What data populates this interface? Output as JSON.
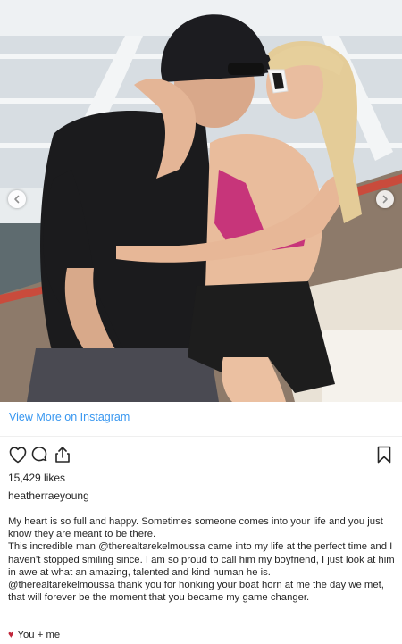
{
  "post": {
    "view_more_label": "View More on Instagram",
    "likes": "15,429 likes",
    "username": "heatherraeyoung",
    "caption": [
      "My heart is so full and happy. Sometimes someone comes into your life and you just know they are meant to be there.",
      "This incredible man @therealtarekelmoussa came into my life at the perfect time and I haven’t stopped smiling since. I am so proud to call him my boyfriend, I just look at him in awe at what an amazing, talented and kind human he is.",
      "@therealtarekelmoussa thank you for honking your boat horn at me the day we met, that will forever be the moment that you became my game changer."
    ],
    "sign_off_emoji": "♥",
    "sign_off_text": "You + me"
  },
  "icons": {
    "heart": "heart-outline-icon",
    "comment": "comment-bubble-icon",
    "share": "share-upload-icon",
    "save": "bookmark-icon",
    "prev": "chevron-left-icon",
    "next": "chevron-right-icon"
  },
  "colors": {
    "link": "#3897f0",
    "text": "#262626",
    "divider": "#efefef",
    "emoji_heart": "#c0263b"
  }
}
